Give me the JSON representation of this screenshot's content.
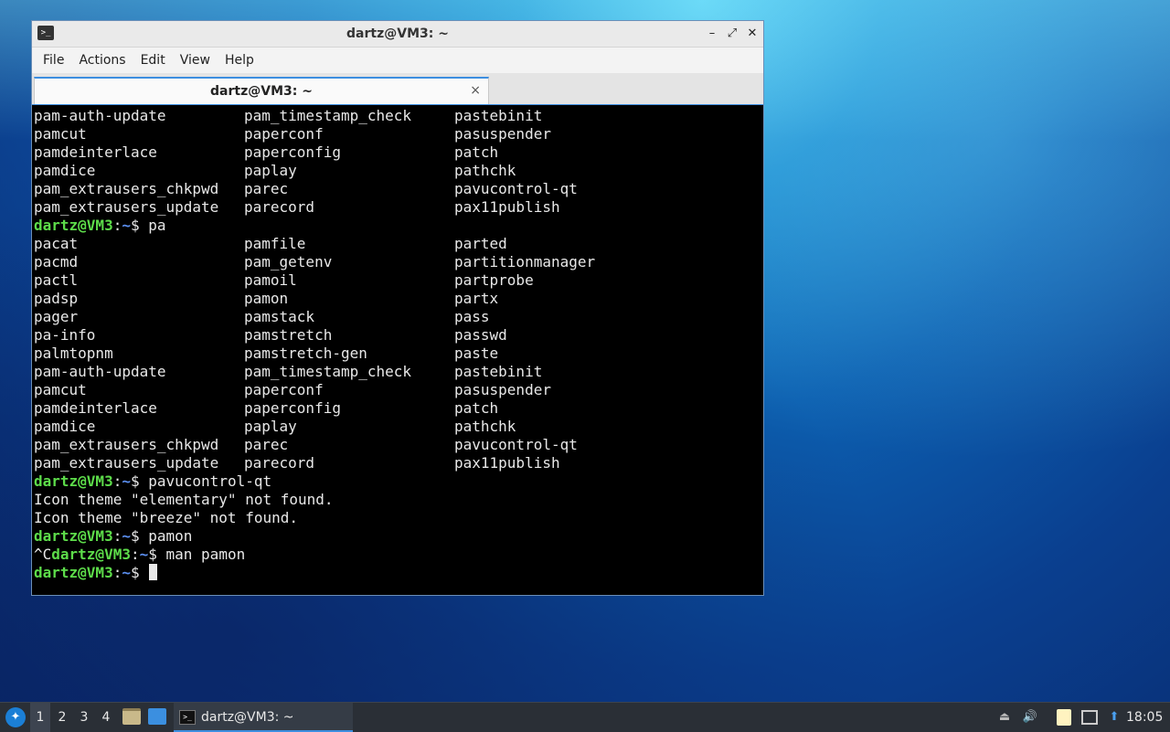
{
  "window": {
    "title": "dartz@VM3: ~",
    "controls": {
      "minimize": "–",
      "maximize": "⤢",
      "close": "✕"
    },
    "menu": [
      "File",
      "Actions",
      "Edit",
      "View",
      "Help"
    ],
    "tab": {
      "label": "dartz@VM3: ~",
      "close": "×"
    }
  },
  "terminal": {
    "prompt": {
      "user": "dartz@VM3",
      "sep": ":",
      "path": "~",
      "symbol": "$ "
    },
    "lines": [
      {
        "type": "cols",
        "cols": [
          "pam-auth-update",
          "pam_timestamp_check",
          "pastebinit"
        ]
      },
      {
        "type": "cols",
        "cols": [
          "pamcut",
          "paperconf",
          "pasuspender"
        ]
      },
      {
        "type": "cols",
        "cols": [
          "pamdeinterlace",
          "paperconfig",
          "patch"
        ]
      },
      {
        "type": "cols",
        "cols": [
          "pamdice",
          "paplay",
          "pathchk"
        ]
      },
      {
        "type": "cols",
        "cols": [
          "pam_extrausers_chkpwd",
          "parec",
          "pavucontrol-qt"
        ]
      },
      {
        "type": "cols",
        "cols": [
          "pam_extrausers_update",
          "parecord",
          "pax11publish"
        ]
      },
      {
        "type": "prompt",
        "pre": "",
        "cmd": "pa"
      },
      {
        "type": "cols",
        "cols": [
          "pacat",
          "pamfile",
          "parted"
        ]
      },
      {
        "type": "cols",
        "cols": [
          "pacmd",
          "pam_getenv",
          "partitionmanager"
        ]
      },
      {
        "type": "cols",
        "cols": [
          "pactl",
          "pamoil",
          "partprobe"
        ]
      },
      {
        "type": "cols",
        "cols": [
          "padsp",
          "pamon",
          "partx"
        ]
      },
      {
        "type": "cols",
        "cols": [
          "pager",
          "pamstack",
          "pass"
        ]
      },
      {
        "type": "cols",
        "cols": [
          "pa-info",
          "pamstretch",
          "passwd"
        ]
      },
      {
        "type": "cols",
        "cols": [
          "palmtopnm",
          "pamstretch-gen",
          "paste"
        ]
      },
      {
        "type": "cols",
        "cols": [
          "pam-auth-update",
          "pam_timestamp_check",
          "pastebinit"
        ]
      },
      {
        "type": "cols",
        "cols": [
          "pamcut",
          "paperconf",
          "pasuspender"
        ]
      },
      {
        "type": "cols",
        "cols": [
          "pamdeinterlace",
          "paperconfig",
          "patch"
        ]
      },
      {
        "type": "cols",
        "cols": [
          "pamdice",
          "paplay",
          "pathchk"
        ]
      },
      {
        "type": "cols",
        "cols": [
          "pam_extrausers_chkpwd",
          "parec",
          "pavucontrol-qt"
        ]
      },
      {
        "type": "cols",
        "cols": [
          "pam_extrausers_update",
          "parecord",
          "pax11publish"
        ]
      },
      {
        "type": "prompt",
        "pre": "",
        "cmd": "pavucontrol-qt"
      },
      {
        "type": "text",
        "text": "Icon theme \"elementary\" not found."
      },
      {
        "type": "text",
        "text": "Icon theme \"breeze\" not found."
      },
      {
        "type": "prompt",
        "pre": "",
        "cmd": "pamon"
      },
      {
        "type": "prompt",
        "pre": "^C",
        "cmd": "man pamon"
      },
      {
        "type": "prompt",
        "pre": "",
        "cmd": "",
        "cursor": true
      }
    ]
  },
  "taskbar": {
    "workspaces": [
      "1",
      "2",
      "3",
      "4"
    ],
    "active_workspace": "1",
    "task_label": "dartz@VM3: ~",
    "clock": "18:05"
  }
}
